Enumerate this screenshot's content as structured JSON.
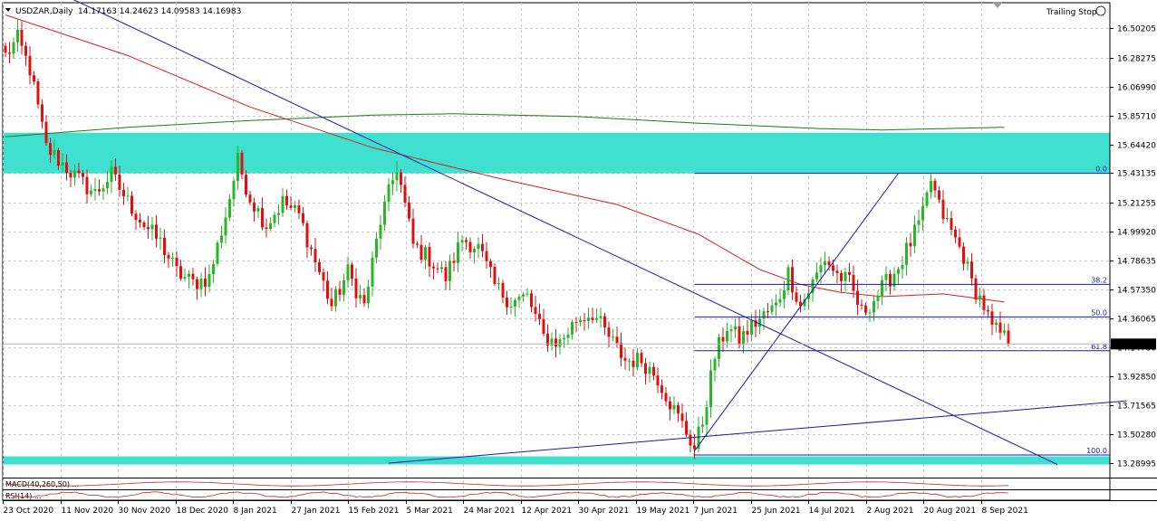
{
  "header": {
    "symbol": "USDZAR,Daily",
    "ohlc": "14.17163 14.24623 14.09583 14.16983"
  },
  "expert": {
    "label": "Trailing Stop"
  },
  "colors": {
    "bull": "#2ab52a",
    "bear": "#e01010",
    "zone": "#40e0d0",
    "trend": "#1a1aa8",
    "ma_fast": "#d42020",
    "ma_slow": "#1e7a1e",
    "grid": "#c8c8c8",
    "price_tag_bg": "#000000"
  },
  "indicators": {
    "macd_label": "MACD(40,260,50) ...",
    "rsi_label": "RSI(14) ..."
  },
  "chart_data": {
    "type": "candlestick",
    "symbol": "USDZAR",
    "timeframe": "Daily",
    "ylim": [
      13.19,
      16.69
    ],
    "current_price": 14.16983,
    "current_price_label": "14.16983",
    "price_ticks": [
      16.50205,
      16.28275,
      16.0699,
      15.8571,
      15.6442,
      15.43135,
      15.21255,
      14.9992,
      14.78635,
      14.5735,
      14.36065,
      14.1478,
      13.9285,
      13.71565,
      13.5028,
      13.28995
    ],
    "price_tick_labels": [
      "16.50205",
      "16.28275",
      "16.06990",
      "15.85710",
      "15.64420",
      "15.43135",
      "15.21255",
      "14.99920",
      "14.78635",
      "14.57350",
      "14.36065",
      "14.14780",
      "13.92850",
      "13.71565",
      "13.50280",
      "13.28995"
    ],
    "date_labels": [
      "23 Oct 2020",
      "11 Nov 2020",
      "30 Nov 2020",
      "18 Dec 2020",
      "8 Jan 2021",
      "27 Jan 2021",
      "15 Feb 2021",
      "5 Mar 2021",
      "24 Mar 2021",
      "12 Apr 2021",
      "30 Apr 2021",
      "19 May 2021",
      "7 Jun 2021",
      "25 Jun 2021",
      "14 Jul 2021",
      "2 Aug 2021",
      "20 Aug 2021",
      "8 Sep 2021"
    ],
    "anchors": [
      [
        0,
        16.3
      ],
      [
        3,
        16.42
      ],
      [
        6,
        16.2
      ],
      [
        10,
        15.62
      ],
      [
        14,
        15.5
      ],
      [
        18,
        15.38
      ],
      [
        22,
        15.28
      ],
      [
        26,
        15.42
      ],
      [
        30,
        15.22
      ],
      [
        34,
        15.05
      ],
      [
        38,
        14.92
      ],
      [
        42,
        14.7
      ],
      [
        46,
        14.62
      ],
      [
        50,
        14.66
      ],
      [
        54,
        15.12
      ],
      [
        57,
        15.52
      ],
      [
        60,
        15.25
      ],
      [
        64,
        15.05
      ],
      [
        68,
        15.22
      ],
      [
        72,
        15.12
      ],
      [
        76,
        14.78
      ],
      [
        80,
        14.45
      ],
      [
        84,
        14.7
      ],
      [
        88,
        14.45
      ],
      [
        92,
        15.08
      ],
      [
        96,
        15.48
      ],
      [
        100,
        14.9
      ],
      [
        104,
        14.8
      ],
      [
        108,
        14.66
      ],
      [
        112,
        14.95
      ],
      [
        116,
        14.88
      ],
      [
        120,
        14.6
      ],
      [
        124,
        14.48
      ],
      [
        128,
        14.52
      ],
      [
        132,
        14.22
      ],
      [
        136,
        14.18
      ],
      [
        140,
        14.35
      ],
      [
        144,
        14.4
      ],
      [
        148,
        14.22
      ],
      [
        152,
        14.05
      ],
      [
        156,
        14.05
      ],
      [
        160,
        13.92
      ],
      [
        164,
        13.68
      ],
      [
        167,
        13.52
      ],
      [
        169,
        13.4
      ],
      [
        171,
        13.6
      ],
      [
        174,
        14.08
      ],
      [
        177,
        14.3
      ],
      [
        180,
        14.2
      ],
      [
        183,
        14.3
      ],
      [
        186,
        14.38
      ],
      [
        189,
        14.45
      ],
      [
        192,
        14.7
      ],
      [
        195,
        14.45
      ],
      [
        198,
        14.62
      ],
      [
        201,
        14.8
      ],
      [
        204,
        14.68
      ],
      [
        207,
        14.62
      ],
      [
        210,
        14.4
      ],
      [
        213,
        14.5
      ],
      [
        216,
        14.62
      ],
      [
        219,
        14.74
      ],
      [
        222,
        14.92
      ],
      [
        225,
        15.12
      ],
      [
        227,
        15.38
      ],
      [
        229,
        15.18
      ],
      [
        232,
        15.0
      ],
      [
        235,
        14.82
      ],
      [
        237,
        14.62
      ],
      [
        240,
        14.45
      ],
      [
        242,
        14.28
      ],
      [
        244,
        14.25
      ],
      [
        246,
        14.18
      ]
    ],
    "sma_fast": [
      [
        0,
        16.6
      ],
      [
        30,
        16.3
      ],
      [
        60,
        15.92
      ],
      [
        90,
        15.62
      ],
      [
        120,
        15.4
      ],
      [
        150,
        15.2
      ],
      [
        170,
        14.98
      ],
      [
        185,
        14.72
      ],
      [
        195,
        14.61
      ],
      [
        205,
        14.55
      ],
      [
        215,
        14.52
      ],
      [
        230,
        14.54
      ],
      [
        245,
        14.48
      ]
    ],
    "sma_slow": [
      [
        0,
        15.7
      ],
      [
        30,
        15.77
      ],
      [
        60,
        15.82
      ],
      [
        90,
        15.86
      ],
      [
        110,
        15.87
      ],
      [
        140,
        15.85
      ],
      [
        170,
        15.8
      ],
      [
        200,
        15.76
      ],
      [
        215,
        15.75
      ],
      [
        230,
        15.76
      ],
      [
        245,
        15.77
      ]
    ],
    "zones": [
      {
        "from": 15.43,
        "to": 15.73
      },
      {
        "from": 13.28,
        "to": 13.34
      }
    ],
    "fibonacci": {
      "levels": [
        {
          "label": "0.0",
          "price": 15.43
        },
        {
          "label": "38.2",
          "price": 14.61
        },
        {
          "label": "50.0",
          "price": 14.37
        },
        {
          "label": "61.8",
          "price": 14.12
        },
        {
          "label": "100.0",
          "price": 13.35
        }
      ],
      "start_bar": 169
    },
    "trendlines": [
      {
        "x1": 0,
        "y1": 16.95,
        "x2": 258,
        "y2": 13.28
      },
      {
        "x1": 94,
        "y1": 13.29,
        "x2": 275,
        "y2": 13.75
      },
      {
        "x1": 169,
        "y1": 13.38,
        "x2": 219,
        "y2": 15.43
      }
    ]
  }
}
